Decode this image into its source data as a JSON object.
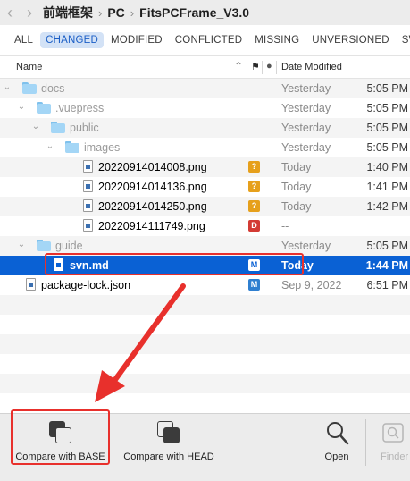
{
  "breadcrumb": {
    "back_icon": "chevron-left-icon",
    "forward_icon": "chevron-right-icon",
    "items": [
      "前端框架",
      "PC",
      "FitsPCFrame_V3.0"
    ],
    "separator": "›"
  },
  "filters": [
    "ALL",
    "CHANGED",
    "MODIFIED",
    "CONFLICTED",
    "MISSING",
    "UNVERSIONED",
    "SW"
  ],
  "active_filter": "CHANGED",
  "columns": {
    "name": "Name",
    "sort_icon": "chevron-up-icon",
    "flag_icon": "flag-icon",
    "status_icon": "dot-icon",
    "date": "Date Modified"
  },
  "rows": [
    {
      "name": "docs",
      "kind": "folder",
      "status": "",
      "date": "Yesterday",
      "time": "5:05 PM"
    },
    {
      "name": ".vuepress",
      "kind": "folder",
      "status": "",
      "date": "Yesterday",
      "time": "5:05 PM"
    },
    {
      "name": "public",
      "kind": "folder",
      "status": "",
      "date": "Yesterday",
      "time": "5:05 PM"
    },
    {
      "name": "images",
      "kind": "folder",
      "status": "",
      "date": "Yesterday",
      "time": "5:05 PM"
    },
    {
      "name": "20220914014008.png",
      "kind": "file",
      "status": "?",
      "date": "Today",
      "time": "1:40 PM"
    },
    {
      "name": "20220914014136.png",
      "kind": "file",
      "status": "?",
      "date": "Today",
      "time": "1:41 PM"
    },
    {
      "name": "20220914014250.png",
      "kind": "file",
      "status": "?",
      "date": "Today",
      "time": "1:42 PM"
    },
    {
      "name": "20220914111749.png",
      "kind": "file",
      "status": "D",
      "date": "--",
      "time": ""
    },
    {
      "name": "guide",
      "kind": "folder",
      "status": "",
      "date": "Yesterday",
      "time": "5:05 PM"
    },
    {
      "name": "svn.md",
      "kind": "file",
      "status": "M",
      "date": "Today",
      "time": "1:44 PM"
    },
    {
      "name": "package-lock.json",
      "kind": "file",
      "status": "M",
      "date": "Sep 9, 2022",
      "time": "6:51 PM"
    }
  ],
  "selected_row": "svn.md",
  "toolbar": {
    "compare_base": "Compare with BASE",
    "compare_head": "Compare with HEAD",
    "open": "Open",
    "finder": "Finder"
  },
  "colors": {
    "selection": "#0a61d4",
    "highlight": "#e8302c",
    "unversioned": "#e6a01c",
    "deleted": "#d33b34",
    "modified": "#2f7fd0"
  }
}
